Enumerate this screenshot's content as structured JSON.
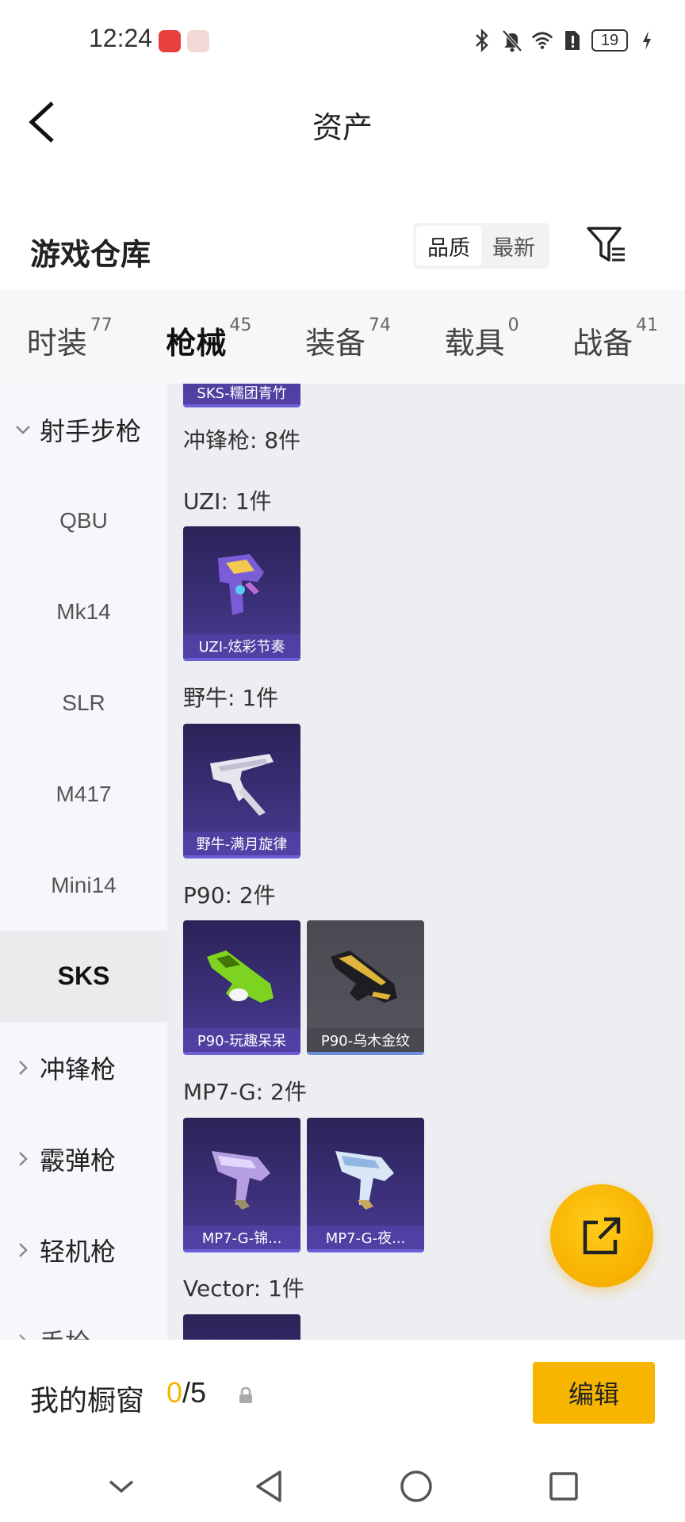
{
  "status_bar": {
    "time": "12:24",
    "battery": "19"
  },
  "header": {
    "title": "资产"
  },
  "warehouse": {
    "title": "游戏仓库",
    "sort": [
      "品质",
      "最新"
    ],
    "active_sort": "品质"
  },
  "tabs": [
    {
      "label": "时装",
      "count": "77"
    },
    {
      "label": "枪械",
      "count": "45"
    },
    {
      "label": "装备",
      "count": "74"
    },
    {
      "label": "载具",
      "count": "0"
    },
    {
      "label": "战备",
      "count": "41"
    }
  ],
  "sidebar": {
    "group_sniper": "射手步枪",
    "items": [
      "QBU",
      "Mk14",
      "SLR",
      "M417",
      "Mini14",
      "SKS"
    ],
    "group_smg": "冲锋枪",
    "group_shotgun": "霰弹枪",
    "group_lmg": "轻机枪",
    "group_pistol": "手枪"
  },
  "content": {
    "top_card": "SKS-糯团青竹",
    "category_title": "冲锋枪: 8件",
    "sections": [
      {
        "label": "UZI: 1件",
        "cards": [
          "UZI-炫彩节奏"
        ]
      },
      {
        "label": "野牛: 1件",
        "cards": [
          "野牛-满月旋律"
        ]
      },
      {
        "label": "P90: 2件",
        "cards": [
          "P90-玩趣呆呆",
          "P90-乌木金纹"
        ]
      },
      {
        "label": "MP7-G: 2件",
        "cards": [
          "MP7-G-锦...",
          "MP7-G-夜..."
        ]
      },
      {
        "label": "Vector: 1件",
        "cards": []
      }
    ]
  },
  "bottom": {
    "label": "我的橱窗",
    "current": "0",
    "total": "/5",
    "edit_label": "编辑"
  },
  "colors": {
    "accent": "#f7b500",
    "card_purple": "#3b2f78",
    "card_gray": "#55555e"
  }
}
